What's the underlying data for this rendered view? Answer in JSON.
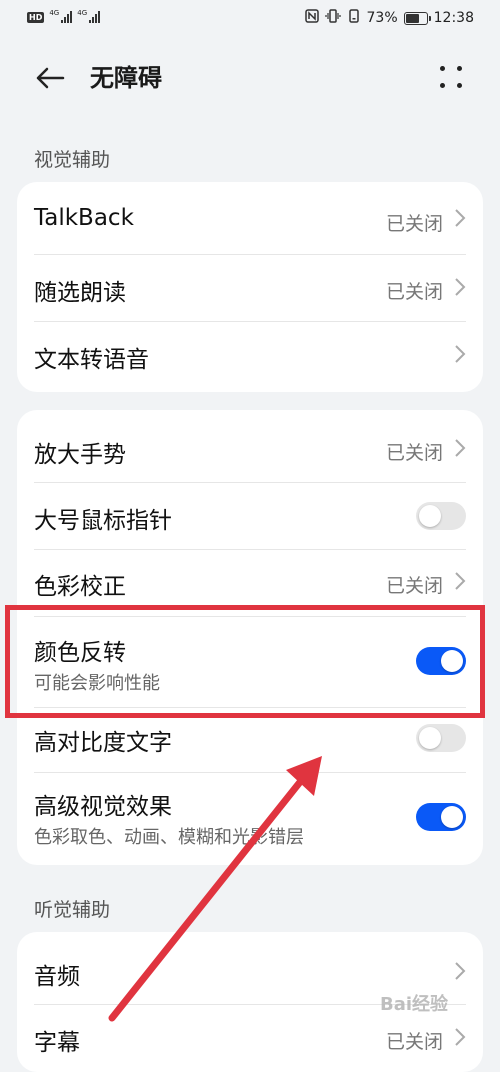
{
  "status_bar": {
    "left_badge": "HD",
    "network_1": "4G",
    "network_2": "4G",
    "battery_text": "73%",
    "battery_level": 0.73,
    "time": "12:38",
    "icons": [
      "nfc-icon",
      "vibrate-icon",
      "vibrate-mode-icon",
      "battery-icon"
    ]
  },
  "header": {
    "title": "无障碍",
    "back_icon": "arrow-left-icon",
    "more_icon": "more-dots-icon"
  },
  "sections": [
    {
      "label": "视觉辅助",
      "cards": [
        {
          "rows": [
            {
              "title": "TalkBack",
              "value": "已关闭",
              "chevron": true
            },
            {
              "title": "随选朗读",
              "value": "已关闭",
              "chevron": true
            },
            {
              "title": "文本转语音",
              "value": "",
              "chevron": true
            }
          ]
        },
        {
          "rows": [
            {
              "title": "放大手势",
              "value": "已关闭",
              "chevron": true
            },
            {
              "title": "大号鼠标指针",
              "toggle": false
            },
            {
              "title": "色彩校正",
              "value": "已关闭",
              "chevron": true
            },
            {
              "title": "颜色反转",
              "subtitle": "可能会影响性能",
              "toggle": true
            },
            {
              "title": "高对比度文字",
              "toggle": false
            },
            {
              "title": "高级视觉效果",
              "subtitle": "色彩取色、动画、模糊和光影错层",
              "toggle": true
            }
          ]
        }
      ]
    },
    {
      "label": "听觉辅助",
      "cards": [
        {
          "rows": [
            {
              "title": "音频",
              "value": "",
              "chevron": true
            },
            {
              "title": "字幕",
              "value": "已关闭",
              "chevron": true
            }
          ]
        }
      ]
    }
  ],
  "annotation": {
    "highlight_color": "#e0343f",
    "arrow_color": "#e0343f"
  },
  "watermark": "Bai经验",
  "colors": {
    "accent": "#0a59f7",
    "background": "#f1f3f5",
    "card": "#ffffff"
  }
}
